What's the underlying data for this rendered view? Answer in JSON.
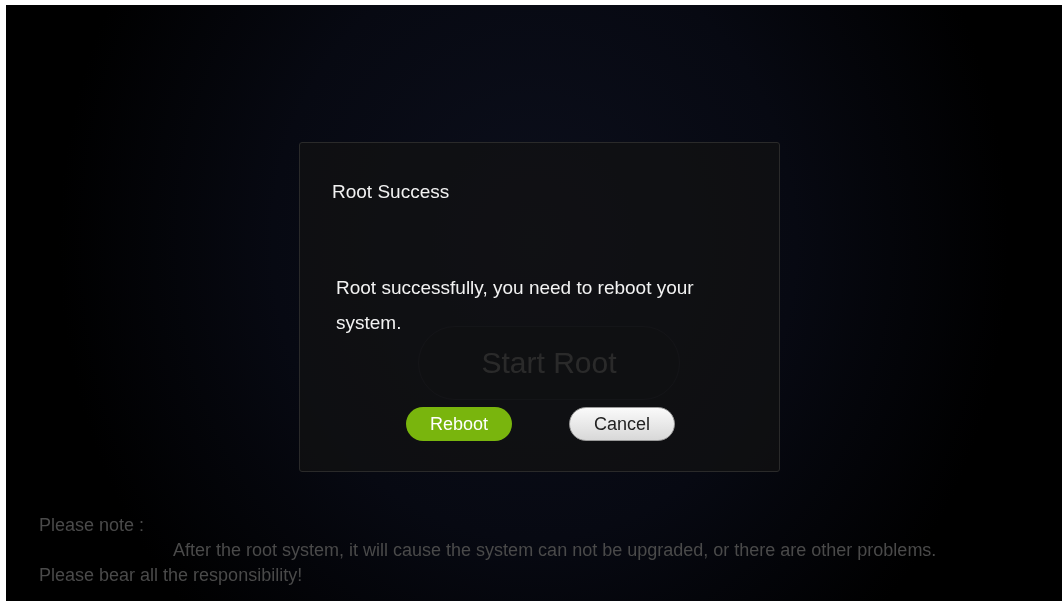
{
  "start_button": {
    "label": "Start Root"
  },
  "dialog": {
    "title": "Root Success",
    "message": "Root successfully, you need to reboot your system.",
    "buttons": [
      {
        "label": "Reboot",
        "kind": "primary"
      },
      {
        "label": "Cancel",
        "kind": "secondary"
      }
    ]
  },
  "note": {
    "heading": "Please note :",
    "text": "After the root system, it will cause the system can not be upgraded, or there are other problems. Please bear all the responsibility!"
  }
}
